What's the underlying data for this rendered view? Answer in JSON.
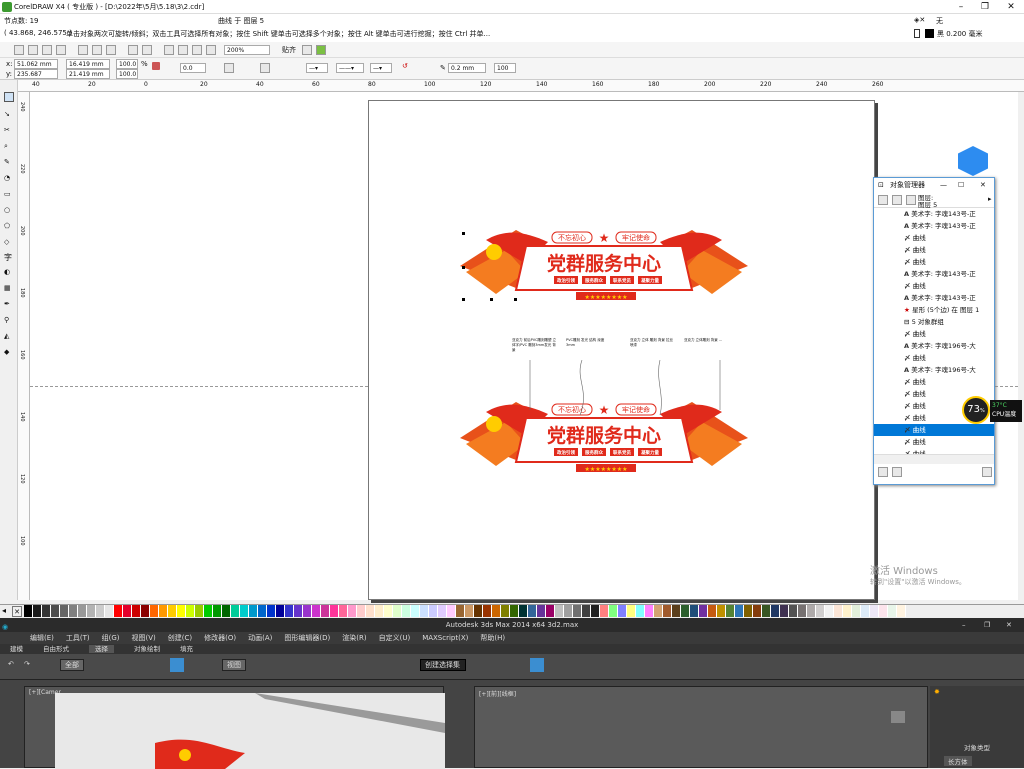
{
  "corel": {
    "title": "CorelDRAW X4 ( 专业版 ) - [D:\\2022年\\5月\\5.18\\3\\2.cdr]",
    "node_count": "节点数: 19",
    "curve_layer": "曲线 于 图层 5",
    "coords": "( 43.868, 246.575 )",
    "hint": "单击对象两次可旋转/倾斜；双击工具可选择所有对象；按住 Shift 键单击可选择多个对象；按住 Alt 键单击可进行挖掘；按住 Ctrl 并单...",
    "fill_none": "无",
    "outline": "黑  0.200 毫米",
    "zoom": "200%",
    "snap": "贴齐",
    "x": "51.062 mm",
    "y": "235.687 mm",
    "w": "16.419 mm",
    "h": "21.419 mm",
    "sx": "100.0",
    "sy": "100.0",
    "pct": "%",
    "angle": "0.0",
    "line_width": "0.2 mm",
    "smooth": "100",
    "ruler_h": [
      "40",
      "20",
      "0",
      "20",
      "40",
      "60",
      "80",
      "100",
      "120",
      "140",
      "160",
      "180",
      "200",
      "220",
      "240",
      "260"
    ],
    "ruler_v": [
      "240",
      "220",
      "200",
      "180",
      "160",
      "140",
      "120",
      "100"
    ]
  },
  "sign": {
    "main_title": "党群服务中心",
    "slogan_left": "不忘初心",
    "slogan_right": "牢记使命",
    "buttons": [
      "政治引领",
      "服务群众",
      "联系党员",
      "凝聚力量"
    ],
    "notes": [
      "亚克力 前后PVC雕刻雕塑 立体字/PVC 雕刻3mm发光 背景",
      "PVC雕刻 发光 结构 深度 3mm",
      "亚克力 立体 雕刻 背景 拉丝 喷漆",
      "亚克力 立体雕刻 背景 ..."
    ]
  },
  "object_manager": {
    "title": "对象管理器",
    "layer_label": "图层:",
    "layer_name": "图层 5",
    "items": [
      {
        "icon": "A",
        "label": "美术字: 字魂143号-正"
      },
      {
        "icon": "A",
        "label": "美术字: 字魂143号-正"
      },
      {
        "icon": "c",
        "label": "曲线"
      },
      {
        "icon": "c",
        "label": "曲线"
      },
      {
        "icon": "c",
        "label": "曲线"
      },
      {
        "icon": "A",
        "label": "美术字: 字魂143号-正"
      },
      {
        "icon": "c",
        "label": "曲线"
      },
      {
        "icon": "A",
        "label": "美术字: 字魂143号-正"
      },
      {
        "icon": "s",
        "label": "星形 (5个边) 在 图层 1"
      },
      {
        "icon": "g",
        "label": "5 对象群组"
      },
      {
        "icon": "c",
        "label": "曲线"
      },
      {
        "icon": "A",
        "label": "美术字: 字魂196号-大"
      },
      {
        "icon": "c",
        "label": "曲线"
      },
      {
        "icon": "A",
        "label": "美术字: 字魂196号-大"
      },
      {
        "icon": "c",
        "label": "曲线"
      },
      {
        "icon": "c",
        "label": "曲线"
      },
      {
        "icon": "c",
        "label": "曲线"
      },
      {
        "icon": "c",
        "label": "曲线"
      },
      {
        "icon": "c",
        "label": "曲线"
      },
      {
        "icon": "c",
        "label": "曲线"
      },
      {
        "icon": "c",
        "label": "曲线"
      }
    ]
  },
  "cpu": {
    "percent": "73",
    "unit": "%",
    "temp": "37°C",
    "label": "CPU温度"
  },
  "activation": {
    "line1": "激活 Windows",
    "line2": "转到\"设置\"以激活 Windows。"
  },
  "max": {
    "title": "Autodesk 3ds Max  2014 x64      3d2.max",
    "menu": [
      "编辑(E)",
      "工具(T)",
      "组(G)",
      "视图(V)",
      "创建(C)",
      "修改器(O)",
      "动画(A)",
      "图形编辑器(D)",
      "渲染(R)",
      "自定义(U)",
      "MAXScript(X)",
      "帮助(H)"
    ],
    "ribbon": [
      "建模",
      "自由形式",
      "选择",
      "对象绘制",
      "填充"
    ],
    "select_all": "全部",
    "view": "视图",
    "named_sel": "创建选择集",
    "vp1": "[+][Camer",
    "vp2": "[+][前][线框]",
    "obj_type": "对象类型",
    "box": "长方体"
  },
  "palette": [
    "#000000",
    "#1a1a1a",
    "#333",
    "#4d4d4d",
    "#666",
    "#808080",
    "#999",
    "#b3b3b3",
    "#ccc",
    "#e6e6e6",
    "#ff0000",
    "#e4002b",
    "#c00",
    "#8b0000",
    "#ff6600",
    "#ff9900",
    "#ffcc00",
    "#ffff00",
    "#ccff00",
    "#99cc00",
    "#00cc00",
    "#009900",
    "#006600",
    "#00cc99",
    "#00cccc",
    "#0099cc",
    "#0066cc",
    "#0033cc",
    "#000099",
    "#3333cc",
    "#6633cc",
    "#9933cc",
    "#cc33cc",
    "#cc3399",
    "#ff3399",
    "#ff6699",
    "#ff99cc",
    "#ffcccc",
    "#ffe0cc",
    "#ffeecc",
    "#ffffcc",
    "#e0ffcc",
    "#ccffe0",
    "#ccffff",
    "#cce0ff",
    "#ccccff",
    "#e0ccff",
    "#ffccff",
    "#996633",
    "#cc9966",
    "#663300",
    "#993300",
    "#cc6600",
    "#808000",
    "#336600",
    "#003333",
    "#336699",
    "#663399",
    "#990066",
    "#c0c0c0",
    "#a0a0a0",
    "#707070",
    "#404040",
    "#202020",
    "#ff8080",
    "#80ff80",
    "#8080ff",
    "#ffff80",
    "#80ffff",
    "#ff80ff",
    "#d4a373",
    "#a05a2c",
    "#5a3e1b",
    "#2c5f2d",
    "#1f4e79",
    "#7030a0",
    "#c55a11",
    "#bf9000",
    "#548235",
    "#2e75b6",
    "#7f6000",
    "#843c0c",
    "#375623",
    "#203864",
    "#3f3151",
    "#525252",
    "#767171",
    "#aeaaaa",
    "#d0cece",
    "#f2f2f2",
    "#fbe5d6",
    "#fff2cc",
    "#e2efda",
    "#ddebf7",
    "#ede7f6",
    "#fce4ec",
    "#e8f5e9",
    "#fff3e0"
  ]
}
